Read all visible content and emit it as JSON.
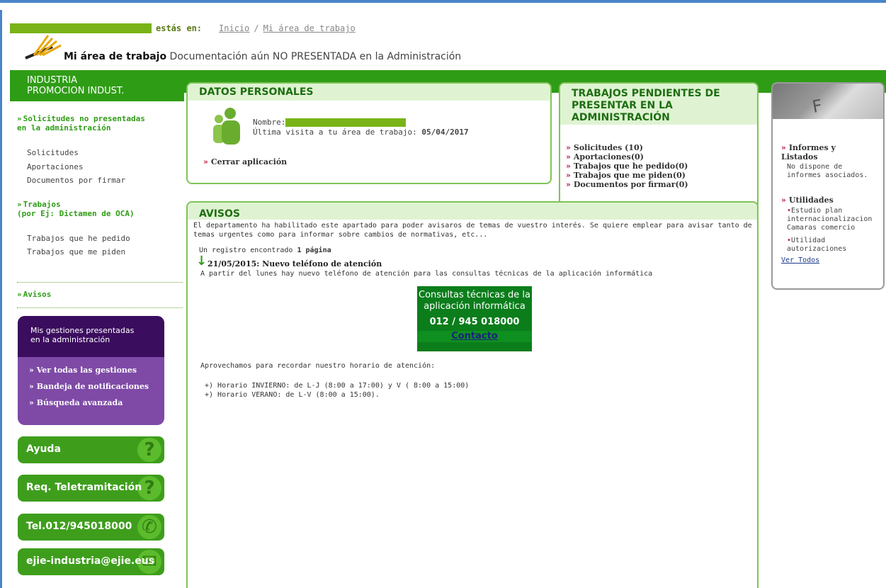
{
  "breadcrumb": {
    "label": "estás en:",
    "items": [
      "Inicio",
      "Mi área de trabajo"
    ],
    "separator": "/"
  },
  "header": {
    "title_bold": "Mi área de trabajo",
    "title_rest": "Documentación aún NO PRESENTADA en la Administración"
  },
  "sidebar": {
    "title_line1": "INDUSTRIA",
    "title_line2": "PROMOCION INDUST.",
    "section1_line1": "Solicitudes no presentadas",
    "section1_line2": "en la administración",
    "section1_links": [
      "Solicitudes",
      "Aportaciones",
      "Documentos por firmar"
    ],
    "section2_line1": "Trabajos",
    "section2_line2": "(por Ej: Dictamen de OCA)",
    "section2_links": [
      "Trabajos que he pedido",
      "Trabajos que me piden"
    ],
    "avisos": "Avisos",
    "purple_title_line1": "Mis gestiones presentadas",
    "purple_title_line2": "en la administración",
    "purple_links": [
      "Ver todas las gestiones",
      "Bandeja de notificaciones",
      "Búsqueda avanzada"
    ],
    "buttons": [
      "Ayuda",
      "Req. Teletramitación",
      "Tel.012/945018000",
      "ejie-industria@ejie.eus"
    ]
  },
  "datos_personales": {
    "title": "DATOS PERSONALES",
    "name_label": "Nombre:",
    "last_visit_label": "Última visita a tu área de trabajo:",
    "last_visit_value": "05/04/2017",
    "logout": "Cerrar aplicación"
  },
  "trabajos": {
    "title_line1": "TRABAJOS PENDIENTES DE",
    "title_line2": "PRESENTAR EN LA",
    "title_line3": "ADMINISTRACIÓN",
    "items": [
      "Solicitudes (10)",
      "Aportaciones(0)",
      "Trabajos que he pedido(0)",
      "Trabajos que me piden(0)",
      "Documentos por firmar(0)"
    ]
  },
  "avisos": {
    "title": "AVISOS",
    "desc": "El departamento ha habilitado este apartado para poder avisaros de temas de vuestro interés. Se quiere emplear para avisar tanto de temas urgentes como para informar sobre cambios de normativas, etc...",
    "count_text": "Un registro encontrado",
    "pages": "1 página",
    "item_title": "21/05/2015: Nuevo teléfono de atención",
    "item_text": "A partir del lunes hay nuevo teléfono de atención para las consultas técnicas de la aplicación informática",
    "contact_line1": "Consultas técnicas de la",
    "contact_line2": "aplicación informática",
    "contact_phone": "012 / 945 018000",
    "contact_link": "Contacto",
    "recuerda": "Aprovechamos para recordar nuestro horario de atención:",
    "horario1": "+)  Horario INVIERNO: de L-J (8:00 a 17:00) y V ( 8:00 a 15:00)",
    "horario2": "+)  Horario VERANO: de L-V (8:00 a 15:00)."
  },
  "right": {
    "img_letter": "F",
    "informes_line1": "Informes y",
    "informes_line2": "Listados",
    "informes_text_line1": "No dispone de",
    "informes_text_line2": "informes asociados.",
    "utilidades": "Utilidades",
    "util1_line1": "Estudio plan",
    "util1_line2": "internacionalizacion",
    "util1_line3": "Camaras comercio",
    "util2_line1": "Utilidad",
    "util2_line2": "autorizaciones",
    "ver_todos": "Ver Todos"
  },
  "colors": {
    "brand_green": "#2f9c16",
    "panel_border": "#7ec455",
    "accent_red": "#c0143c",
    "purple_dark": "#3b0d5e",
    "purple": "#7e4aa6"
  }
}
